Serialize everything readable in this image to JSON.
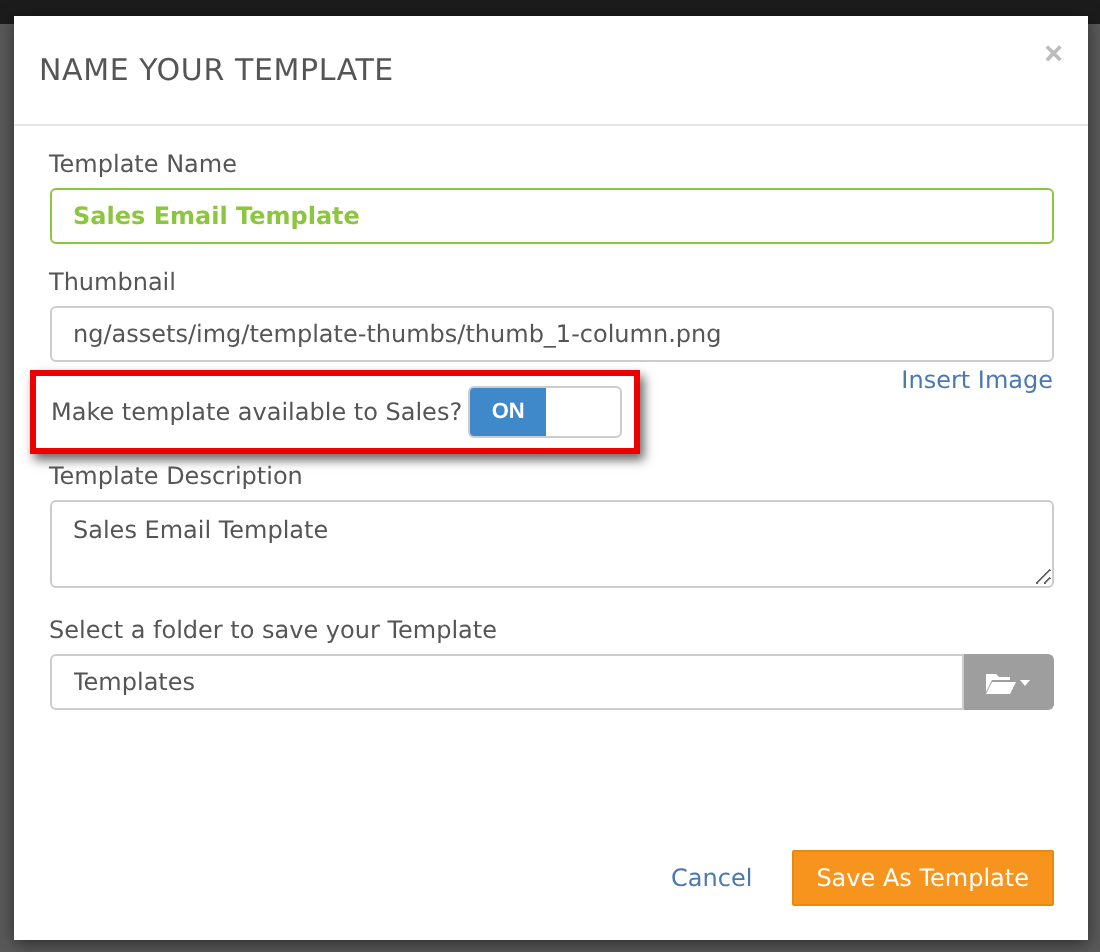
{
  "dialog": {
    "title": "NAME YOUR TEMPLATE",
    "close": "×"
  },
  "template_name": {
    "label": "Template Name",
    "value": "Sales Email Template",
    "focused": true
  },
  "thumbnail": {
    "label": "Thumbnail",
    "value": "ng/assets/img/template-thumbs/thumb_1-column.png",
    "link": "Insert Image"
  },
  "sales_toggle": {
    "label": "Make template available to Sales?",
    "on": true,
    "on_label": "ON",
    "highlighted": true
  },
  "description": {
    "label": "Template Description",
    "value": "Sales Email Template"
  },
  "folder": {
    "label": "Select a folder to save your Template",
    "value": "Templates"
  },
  "buttons": [
    {
      "label": "Cancel",
      "kind": "link"
    },
    {
      "label": "Save As Template",
      "kind": "primary"
    }
  ]
}
